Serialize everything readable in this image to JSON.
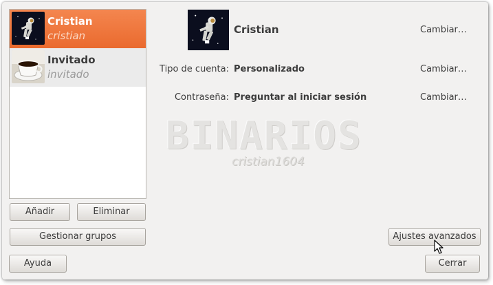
{
  "users": [
    {
      "name": "Cristian",
      "login": "cristian",
      "avatar": "astronaut-image",
      "selected": true
    },
    {
      "name": "Invitado",
      "login": "invitado",
      "avatar": "coffee-cup-image",
      "selected": false
    }
  ],
  "list_buttons": {
    "add": "Añadir",
    "remove": "Eliminar",
    "groups": "Gestionar grupos"
  },
  "details": {
    "name": "Cristian",
    "account_type_label": "Tipo de cuenta:",
    "account_type_value": "Personalizado",
    "password_label": "Contraseña:",
    "password_value": "Preguntar al iniciar sesión",
    "change_label": "Cambiar…"
  },
  "buttons": {
    "advanced": "Ajustes avanzados",
    "help": "Ayuda",
    "close": "Cerrar"
  },
  "watermark": {
    "title": "BINARIOS",
    "subtitle": "cristian1604"
  },
  "colors": {
    "selection": "#ef7640",
    "window_bg": "#f2f1f0"
  }
}
